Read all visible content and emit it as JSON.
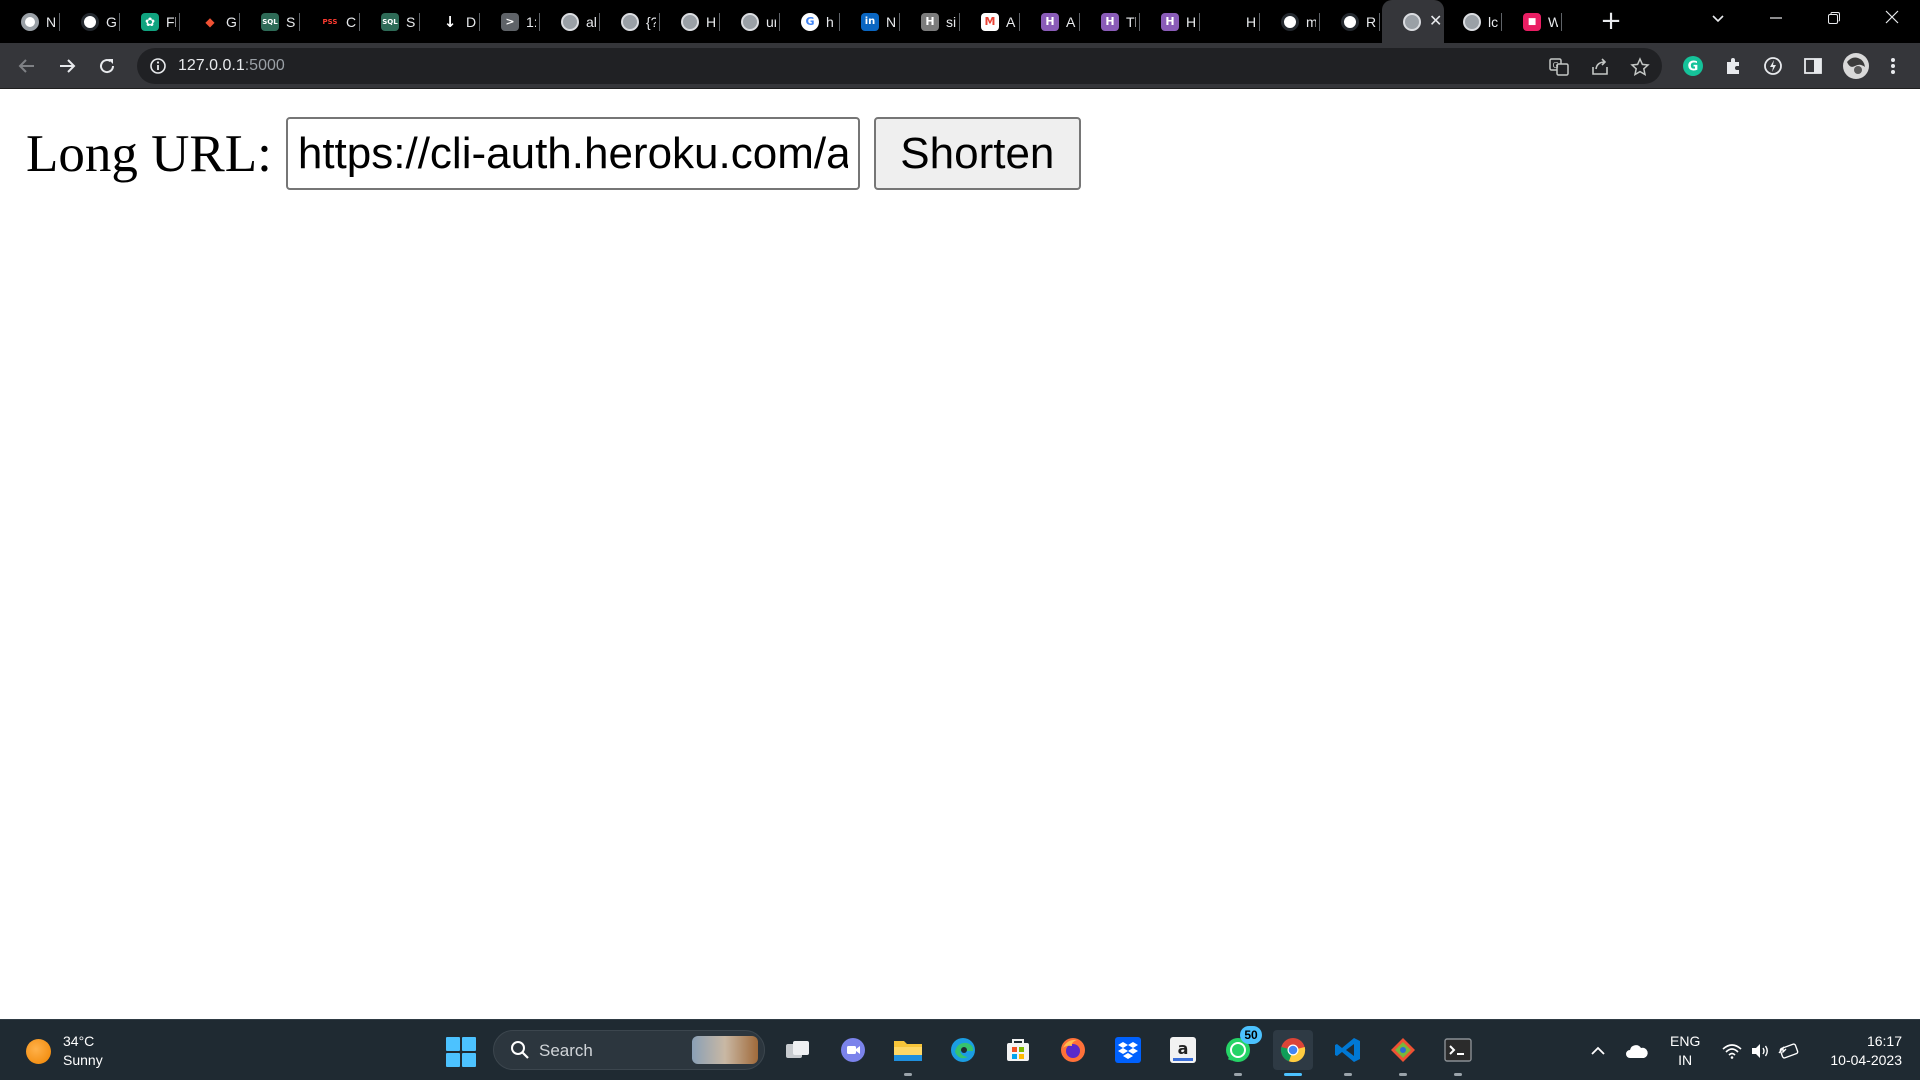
{
  "browser": {
    "tabs": [
      {
        "fav": "chrome-icon",
        "title": "N",
        "color": "#3c4043"
      },
      {
        "fav": "github-icon",
        "title": "G",
        "color": "#24292f"
      },
      {
        "fav": "chatgpt-icon",
        "title": "Fl",
        "color": "#10a37f"
      },
      {
        "fav": "git-icon",
        "title": "G",
        "color": "#f05133"
      },
      {
        "fav": "sql-icon",
        "title": "S(",
        "color": "#2e6b57"
      },
      {
        "fav": "pss-icon",
        "title": "C",
        "color": "#d32f2f"
      },
      {
        "fav": "sql-icon",
        "title": "S(",
        "color": "#2e6b57"
      },
      {
        "fav": "download-icon",
        "title": "D",
        "color": "#000000"
      },
      {
        "fav": "terminal-icon",
        "title": "1:",
        "color": "#5f6368"
      },
      {
        "fav": "globe-icon",
        "title": "al",
        "color": "#5f6368"
      },
      {
        "fav": "globe-icon",
        "title": "{?",
        "color": "#5f6368"
      },
      {
        "fav": "globe-icon",
        "title": "H",
        "color": "#5f6368"
      },
      {
        "fav": "globe-icon",
        "title": "ur",
        "color": "#5f6368"
      },
      {
        "fav": "google-icon",
        "title": "h",
        "color": "#ffffff"
      },
      {
        "fav": "linkedin-icon",
        "title": "N",
        "color": "#0a66c2"
      },
      {
        "fav": "hashnode-icon",
        "title": "si",
        "color": "#7c7c7c"
      },
      {
        "fav": "gmail-icon",
        "title": "A",
        "color": "#ffffff"
      },
      {
        "fav": "hackerrank-icon",
        "title": "A",
        "color": "#8a5cb8"
      },
      {
        "fav": "hackerrank-icon",
        "title": "Tl",
        "color": "#8a5cb8"
      },
      {
        "fav": "hackerrank-icon",
        "title": "H",
        "color": "#8a5cb8"
      },
      {
        "fav": "blank-icon",
        "title": "H",
        "color": "#000000"
      },
      {
        "fav": "github-icon",
        "title": "m",
        "color": "#24292f"
      },
      {
        "fav": "github-icon",
        "title": "R",
        "color": "#24292f"
      },
      {
        "fav": "globe-icon",
        "title": "",
        "color": "#5f6368",
        "active": true
      },
      {
        "fav": "globe-icon",
        "title": "lc",
        "color": "#5f6368"
      },
      {
        "fav": "gift-icon",
        "title": "W",
        "color": "#e91e63"
      }
    ],
    "address": {
      "host": "127.0.0.1",
      "port": ":5000"
    }
  },
  "page": {
    "label": "Long URL:",
    "input_value": "https://cli-auth.heroku.com/a",
    "button_label": "Shorten"
  },
  "taskbar": {
    "weather_temp": "34°C",
    "weather_desc": "Sunny",
    "search_label": "Search",
    "whatsapp_badge": "50",
    "lang_line1": "ENG",
    "lang_line2": "IN",
    "time": "16:17",
    "date": "10-04-2023"
  }
}
